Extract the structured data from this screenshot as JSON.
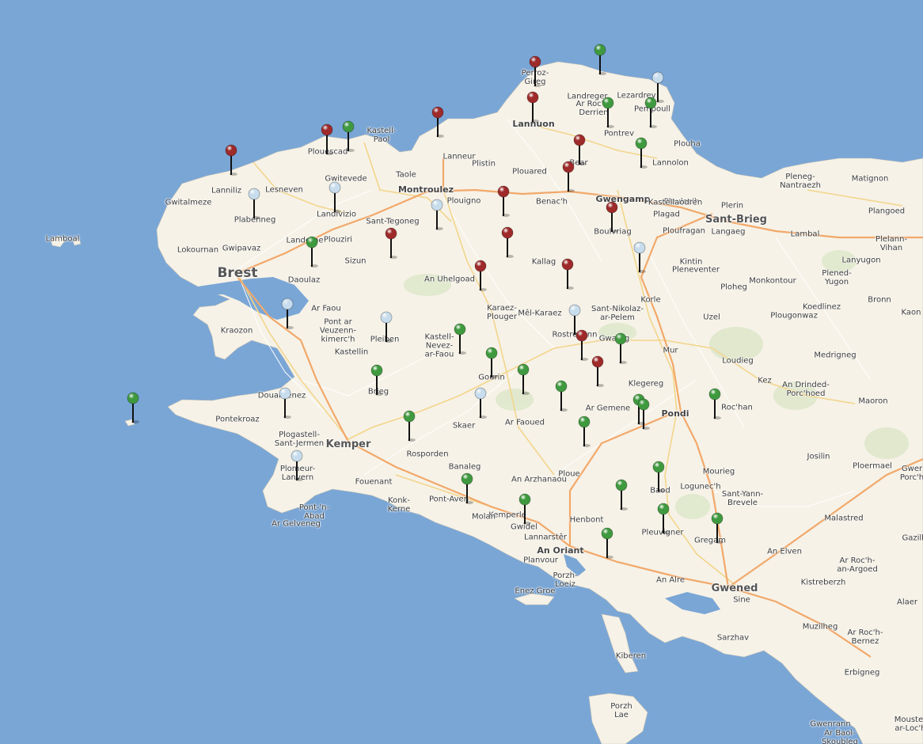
{
  "map": {
    "colors": {
      "sea": "#7aa6d6",
      "land": "#f6f2e7",
      "park": "#dfe8cc",
      "primary_road": "#f2a86a",
      "secondary_road": "#f3d58c",
      "minor_road": "#ffffff"
    },
    "marker_colors": {
      "green": "#3f9a3f",
      "red": "#9e2a2a",
      "lightblue": "#c7dded"
    }
  },
  "places": [
    {
      "text": "Brest",
      "size": "big"
    },
    {
      "text": "Kemper",
      "size": "med"
    },
    {
      "text": "Montroulez",
      "size": "mid"
    },
    {
      "text": "Lannuon",
      "size": "mid"
    },
    {
      "text": "Gwengamp",
      "size": "mid"
    },
    {
      "text": "Sant-Brieg",
      "size": "med"
    },
    {
      "text": "Pondi",
      "size": "mid"
    },
    {
      "text": "An Oriant",
      "size": "mid"
    },
    {
      "text": "Gwened",
      "size": "med"
    },
    {
      "text": "Perroz-\nGireg",
      "size": "small"
    },
    {
      "text": "Landreger",
      "size": "small"
    },
    {
      "text": "Lezardrev",
      "size": "small"
    },
    {
      "text": "Ar Roc'h-\nDerrien",
      "size": "small"
    },
    {
      "text": "Pempoull",
      "size": "small"
    },
    {
      "text": "Pontrev",
      "size": "small"
    },
    {
      "text": "Plouha",
      "size": "small"
    },
    {
      "text": "Lannolon",
      "size": "small"
    },
    {
      "text": "Kastell-\nPaol",
      "size": "small"
    },
    {
      "text": "Plouescad",
      "size": "small"
    },
    {
      "text": "Gwitevede",
      "size": "small"
    },
    {
      "text": "Lanniliz",
      "size": "small"
    },
    {
      "text": "Lesneven",
      "size": "small"
    },
    {
      "text": "Gwitalmeze",
      "size": "small"
    },
    {
      "text": "Lamboal",
      "size": "small"
    },
    {
      "text": "Lanneur",
      "size": "small"
    },
    {
      "text": "Plistin",
      "size": "small"
    },
    {
      "text": "Plouared",
      "size": "small"
    },
    {
      "text": "Taole",
      "size": "small"
    },
    {
      "text": "Bear",
      "size": "small"
    },
    {
      "text": "Benac'h",
      "size": "small"
    },
    {
      "text": "Pleuloc'h",
      "size": "small"
    },
    {
      "text": "Kastellaodren",
      "size": "small"
    },
    {
      "text": "Plagad",
      "size": "small"
    },
    {
      "text": "Plerin",
      "size": "small"
    },
    {
      "text": "Pleneg-\nNantraezh",
      "size": "small"
    },
    {
      "text": "Matignon",
      "size": "small"
    },
    {
      "text": "Plangoed",
      "size": "small"
    },
    {
      "text": "Lambal",
      "size": "small"
    },
    {
      "text": "Ploufragan",
      "size": "small"
    },
    {
      "text": "Langaeg",
      "size": "small"
    },
    {
      "text": "Plelann-\nVihan",
      "size": "small"
    },
    {
      "text": "Lanyugon",
      "size": "small"
    },
    {
      "text": "Plened-\nYugon",
      "size": "small"
    },
    {
      "text": "Bronn",
      "size": "small"
    },
    {
      "text": "Kaon",
      "size": "small"
    },
    {
      "text": "Plabenneg",
      "size": "small"
    },
    {
      "text": "Landivizio",
      "size": "small"
    },
    {
      "text": "Sant-Tegoneg",
      "size": "small"
    },
    {
      "text": "Plouigno",
      "size": "small"
    },
    {
      "text": "Boulvriag",
      "size": "small"
    },
    {
      "text": "Lokournan",
      "size": "small"
    },
    {
      "text": "Gwipavaz",
      "size": "small"
    },
    {
      "text": "Landerne",
      "size": "small"
    },
    {
      "text": "Plouziri",
      "size": "small"
    },
    {
      "text": "Sizun",
      "size": "small"
    },
    {
      "text": "Kallag",
      "size": "small"
    },
    {
      "text": "Kintin",
      "size": "small"
    },
    {
      "text": "Pleneventer",
      "size": "small"
    },
    {
      "text": "Daoulaz",
      "size": "small"
    },
    {
      "text": "An Uhelgoad",
      "size": "small"
    },
    {
      "text": "Ploheg",
      "size": "small"
    },
    {
      "text": "Monkontour",
      "size": "small"
    },
    {
      "text": "Korle",
      "size": "small"
    },
    {
      "text": "Ar Faou",
      "size": "small"
    },
    {
      "text": "Karaez-\nPlouger",
      "size": "small"
    },
    {
      "text": "Mêl-Karaez",
      "size": "small"
    },
    {
      "text": "Sant-Nikolaz-\nar-Pelem",
      "size": "small"
    },
    {
      "text": "Koedlinez",
      "size": "small"
    },
    {
      "text": "Kraozon",
      "size": "small"
    },
    {
      "text": "Pont ar\nVeuzenn-\nkimerc'h",
      "size": "small"
    },
    {
      "text": "Uzel",
      "size": "small"
    },
    {
      "text": "Plougonwaz",
      "size": "small"
    },
    {
      "text": "Pleiben",
      "size": "small"
    },
    {
      "text": "Kastell-\nNevez-\nar-Faou",
      "size": "small"
    },
    {
      "text": "Rostrenenn",
      "size": "small"
    },
    {
      "text": "Kastellin",
      "size": "small"
    },
    {
      "text": "Gwareg",
      "size": "small"
    },
    {
      "text": "Mur",
      "size": "small"
    },
    {
      "text": "Medrigneg",
      "size": "small"
    },
    {
      "text": "Loudieg",
      "size": "small"
    },
    {
      "text": "Gourin",
      "size": "small"
    },
    {
      "text": "Klegereg",
      "size": "small"
    },
    {
      "text": "Kez",
      "size": "small"
    },
    {
      "text": "An Drinded-\nPorc'hoed",
      "size": "small"
    },
    {
      "text": "Douarnenez",
      "size": "small"
    },
    {
      "text": "Brieg",
      "size": "small"
    },
    {
      "text": "Ar Gemene",
      "size": "small"
    },
    {
      "text": "Maoron",
      "size": "small"
    },
    {
      "text": "Pontekroaz",
      "size": "small"
    },
    {
      "text": "Skaer",
      "size": "small"
    },
    {
      "text": "Ar Faoued",
      "size": "small"
    },
    {
      "text": "Roc'han",
      "size": "small"
    },
    {
      "text": "Plogastell-\nSant-Jermen",
      "size": "small"
    },
    {
      "text": "Rosporden",
      "size": "small"
    },
    {
      "text": "Josilin",
      "size": "small"
    },
    {
      "text": "Ploermael",
      "size": "small"
    },
    {
      "text": "Banaleg",
      "size": "small"
    },
    {
      "text": "Ploue",
      "size": "small"
    },
    {
      "text": "Mourieg",
      "size": "small"
    },
    {
      "text": "Plomeur-\nLanvern",
      "size": "small"
    },
    {
      "text": "Pont-'n-\nAbad",
      "size": "small"
    },
    {
      "text": "Fouenant",
      "size": "small"
    },
    {
      "text": "An Arzhanaou",
      "size": "small"
    },
    {
      "text": "Baod",
      "size": "small"
    },
    {
      "text": "Logunec'h",
      "size": "small"
    },
    {
      "text": "Sant-Yann-\nBrevele",
      "size": "small"
    },
    {
      "text": "Gwer\nPorc'h",
      "size": "small"
    },
    {
      "text": "Konk-\nKerne",
      "size": "small"
    },
    {
      "text": "Pont-Aven",
      "size": "small"
    },
    {
      "text": "Kemperle",
      "size": "small"
    },
    {
      "text": "Molan",
      "size": "small"
    },
    {
      "text": "Gwidel",
      "size": "small"
    },
    {
      "text": "Henbont",
      "size": "small"
    },
    {
      "text": "Pleuvigner",
      "size": "small"
    },
    {
      "text": "Gregam",
      "size": "small"
    },
    {
      "text": "Malastred",
      "size": "small"
    },
    {
      "text": "Gazilh",
      "size": "small"
    },
    {
      "text": "Ar Gelveneg",
      "size": "small"
    },
    {
      "text": "Lannarstêr",
      "size": "small"
    },
    {
      "text": "Planvour",
      "size": "small"
    },
    {
      "text": "Porzh-\nLoeiz",
      "size": "small"
    },
    {
      "text": "An Elven",
      "size": "small"
    },
    {
      "text": "Ar Roc'h-\nan-Argoed",
      "size": "small"
    },
    {
      "text": "Enez Groe",
      "size": "small"
    },
    {
      "text": "An Alre",
      "size": "small"
    },
    {
      "text": "Kistreberzh",
      "size": "small"
    },
    {
      "text": "Alaer",
      "size": "small"
    },
    {
      "text": "Sine",
      "size": "small"
    },
    {
      "text": "Muzilheg",
      "size": "small"
    },
    {
      "text": "Ar Roc'h-\nBernez",
      "size": "small"
    },
    {
      "text": "Sarzhav",
      "size": "small"
    },
    {
      "text": "Kiberen",
      "size": "small"
    },
    {
      "text": "Erbigneg",
      "size": "small"
    },
    {
      "text": "Porzh\nLae",
      "size": "small"
    },
    {
      "text": "Gwenrann",
      "size": "small"
    },
    {
      "text": "Ar Baol-\nSkoubleg",
      "size": "small"
    },
    {
      "text": "Mouster\nar-Loc'h",
      "size": "small"
    }
  ],
  "markers": [
    {
      "color": "green"
    },
    {
      "color": "red"
    },
    {
      "color": "lightblue"
    },
    {
      "color": "red"
    },
    {
      "color": "green"
    },
    {
      "color": "green"
    },
    {
      "color": "red"
    },
    {
      "color": "green"
    },
    {
      "color": "red"
    },
    {
      "color": "red"
    },
    {
      "color": "red"
    },
    {
      "color": "green"
    },
    {
      "color": "red"
    },
    {
      "color": "lightblue"
    },
    {
      "color": "lightblue"
    },
    {
      "color": "lightblue"
    },
    {
      "color": "red"
    },
    {
      "color": "red"
    },
    {
      "color": "red"
    },
    {
      "color": "green"
    },
    {
      "color": "lightblue"
    },
    {
      "color": "red"
    },
    {
      "color": "red"
    },
    {
      "color": "lightblue"
    },
    {
      "color": "lightblue"
    },
    {
      "color": "lightblue"
    },
    {
      "color": "green"
    },
    {
      "color": "lightblue"
    },
    {
      "color": "red"
    },
    {
      "color": "green"
    },
    {
      "color": "red"
    },
    {
      "color": "green"
    },
    {
      "color": "green"
    },
    {
      "color": "green"
    },
    {
      "color": "red"
    },
    {
      "color": "green"
    },
    {
      "color": "green"
    },
    {
      "color": "lightblue"
    },
    {
      "color": "green"
    },
    {
      "color": "green"
    },
    {
      "color": "green"
    },
    {
      "color": "green"
    },
    {
      "color": "lightblue"
    },
    {
      "color": "green"
    },
    {
      "color": "green"
    },
    {
      "color": "green"
    },
    {
      "color": "green"
    },
    {
      "color": "green"
    },
    {
      "color": "green"
    },
    {
      "color": "green"
    },
    {
      "color": "green"
    }
  ]
}
